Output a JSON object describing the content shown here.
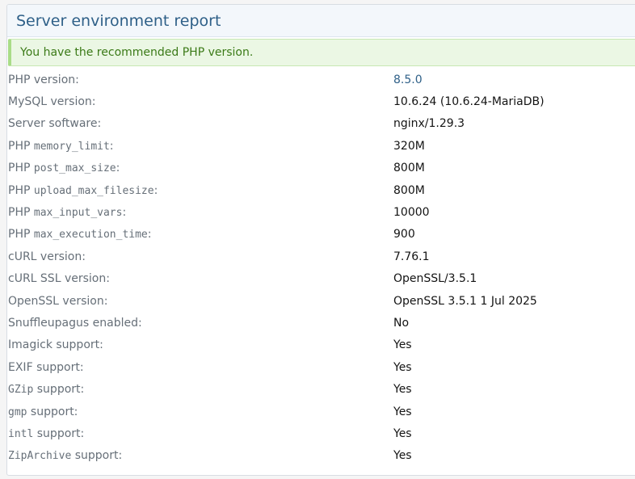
{
  "panel": {
    "title": "Server environment report"
  },
  "notice": {
    "text": "You have the recommended PHP version."
  },
  "rows": [
    {
      "prefix": "",
      "code": "",
      "suffix": "PHP version:",
      "value": "8.5.0"
    },
    {
      "prefix": "",
      "code": "",
      "suffix": "MySQL version:",
      "value": "10.6.24 (10.6.24-MariaDB)"
    },
    {
      "prefix": "",
      "code": "",
      "suffix": "Server software:",
      "value": "nginx/1.29.3"
    },
    {
      "prefix": "PHP ",
      "code": "memory_limit",
      "suffix": ":",
      "value": "320M"
    },
    {
      "prefix": "PHP ",
      "code": "post_max_size",
      "suffix": ":",
      "value": "800M"
    },
    {
      "prefix": "PHP ",
      "code": "upload_max_filesize",
      "suffix": ":",
      "value": "800M"
    },
    {
      "prefix": "PHP ",
      "code": "max_input_vars",
      "suffix": ":",
      "value": "10000"
    },
    {
      "prefix": "PHP ",
      "code": "max_execution_time",
      "suffix": ":",
      "value": "900"
    },
    {
      "prefix": "",
      "code": "",
      "suffix": "cURL version:",
      "value": "7.76.1"
    },
    {
      "prefix": "",
      "code": "",
      "suffix": "cURL SSL version:",
      "value": "OpenSSL/3.5.1"
    },
    {
      "prefix": "",
      "code": "",
      "suffix": "OpenSSL version:",
      "value": "OpenSSL 3.5.1 1 Jul 2025"
    },
    {
      "prefix": "",
      "code": "",
      "suffix": "Snuffleupagus enabled:",
      "value": "No"
    },
    {
      "prefix": "",
      "code": "",
      "suffix": "Imagick support:",
      "value": "Yes"
    },
    {
      "prefix": "",
      "code": "",
      "suffix": "EXIF support:",
      "value": "Yes"
    },
    {
      "prefix": "",
      "code": "GZip",
      "suffix": " support:",
      "value": "Yes"
    },
    {
      "prefix": "",
      "code": "gmp",
      "suffix": " support:",
      "value": "Yes"
    },
    {
      "prefix": "",
      "code": "intl",
      "suffix": " support:",
      "value": "Yes"
    },
    {
      "prefix": "",
      "code": "ZipArchive",
      "suffix": " support:",
      "value": "Yes"
    }
  ],
  "colors": {
    "title": "#2f6088",
    "link": "#2f6088",
    "label": "#666f78",
    "success_text": "#3b7a17",
    "success_bg": "#ebf7e4"
  }
}
